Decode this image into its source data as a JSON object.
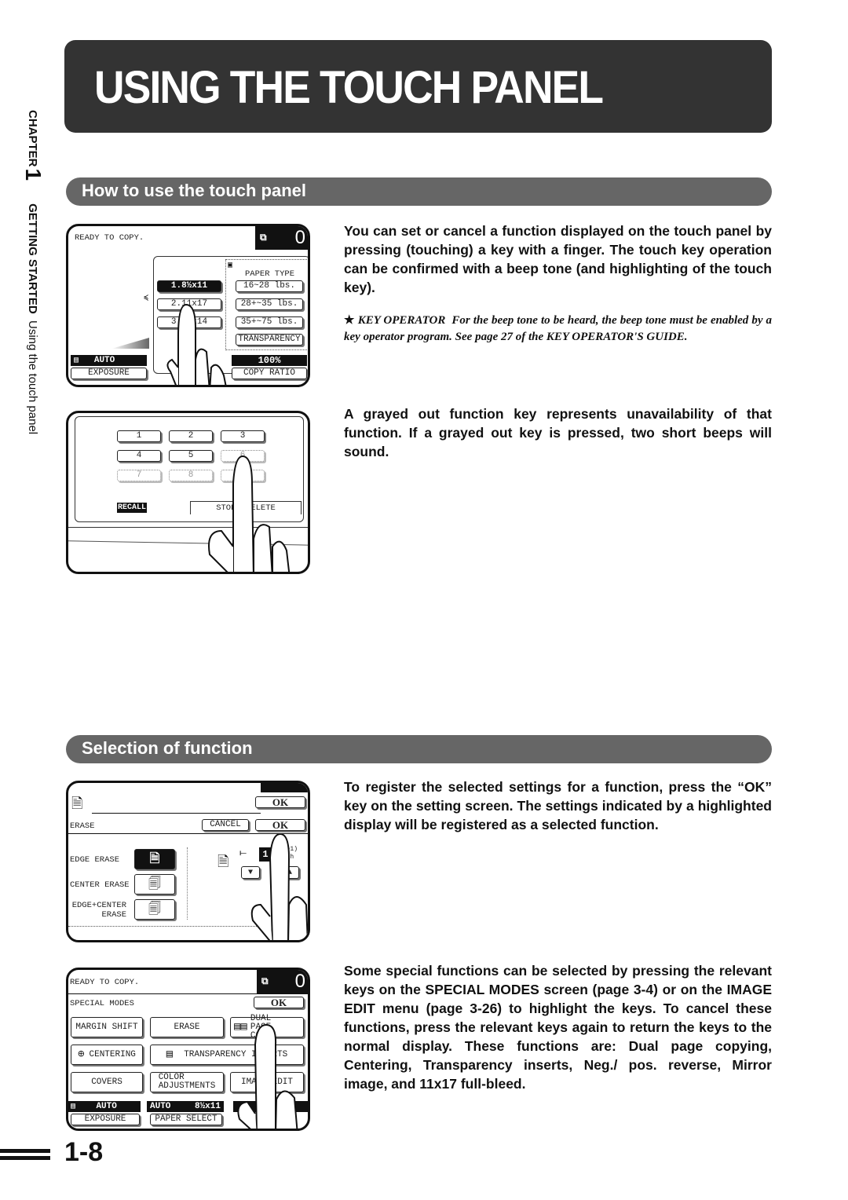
{
  "page": {
    "title": "USING THE TOUCH PANEL",
    "page_number": "1-8",
    "side_tab": {
      "chapter_label": "CHAPTER",
      "chapter_number": "1",
      "section_bold": "GETTING STARTED",
      "section_name": "Using the touch panel"
    }
  },
  "section1": {
    "heading": "How to use the touch panel",
    "paragraph1": "You can set or cancel a function displayed on the touch panel by pressing (touching) a key with a finger. The touch key operation can be confirmed with a beep tone (and highlighting of the touch key).",
    "note_label": "KEY OPERATOR",
    "note_text": "For the beep tone to be heard, the beep tone must be enabled by a key operator program. See page 27 of the KEY OPERATOR'S GUIDE.",
    "note_icon": "star-icon",
    "paragraph2": "A grayed out function key represents unavailability of that function. If a grayed out key is pressed, two short beeps will sound."
  },
  "section2": {
    "heading": "Selection of function",
    "paragraph1": "To register the selected settings for a function, press the “OK” key on the setting screen. The settings indicated by a highlighted display will be registered as a selected function.",
    "paragraph2": "Some special functions can be selected by pressing the relevant keys on the SPECIAL MODES screen (page 3-4) or on the IMAGE EDIT menu (page 3-26) to highlight the keys. To cancel these functions, press the relevant keys again to return the keys to the normal display. These functions are: Dual page copying, Centering, Transparency inserts, Neg./ pos. reverse, Mirror image, and 11x17 full-bleed."
  },
  "screen1": {
    "status": "READY TO COPY.",
    "copy_count": "0",
    "paper_sizes": [
      "1.8½x11",
      "2.11x17",
      "3.8½x14"
    ],
    "paper_type_label": "PAPER TYPE",
    "paper_types": [
      "16~28  lbs.",
      "28+~35 lbs.",
      "35+~75 lbs.",
      "TRANSPARENCY"
    ],
    "exposure_value": "AUTO",
    "exposure_label": "EXPOSURE",
    "ratio_value": "100%",
    "ratio_label": "COPY RATIO"
  },
  "screen2": {
    "keys": [
      "1",
      "2",
      "3",
      "4",
      "5",
      "6",
      "7",
      "8",
      "9"
    ],
    "recall": "RECALL",
    "store_delete": "STORE/DELETE"
  },
  "screen3": {
    "ok_top": "OK",
    "title": "ERASE",
    "cancel": "CANCEL",
    "ok": "OK",
    "options": [
      "EDGE ERASE",
      "CENTER ERASE",
      "EDGE+CENTER ERASE"
    ],
    "value": "1",
    "unit": "(0~1) inch"
  },
  "screen4": {
    "status": "READY TO COPY.",
    "copy_count": "0",
    "title": "SPECIAL MODES",
    "ok": "OK",
    "keys": [
      "MARGIN SHIFT",
      "ERASE",
      "DUAL PAGE COPY",
      "CENTERING",
      "TRANSPARENCY INSERTS",
      "COVERS",
      "COLOR ADJUSTMENTS",
      "IMAGE EDIT"
    ],
    "exposure_value": "AUTO",
    "exposure_label": "EXPOSURE",
    "paper_value_left": "AUTO",
    "paper_value_right": "8½x11",
    "paper_label": "PAPER SELECT"
  }
}
